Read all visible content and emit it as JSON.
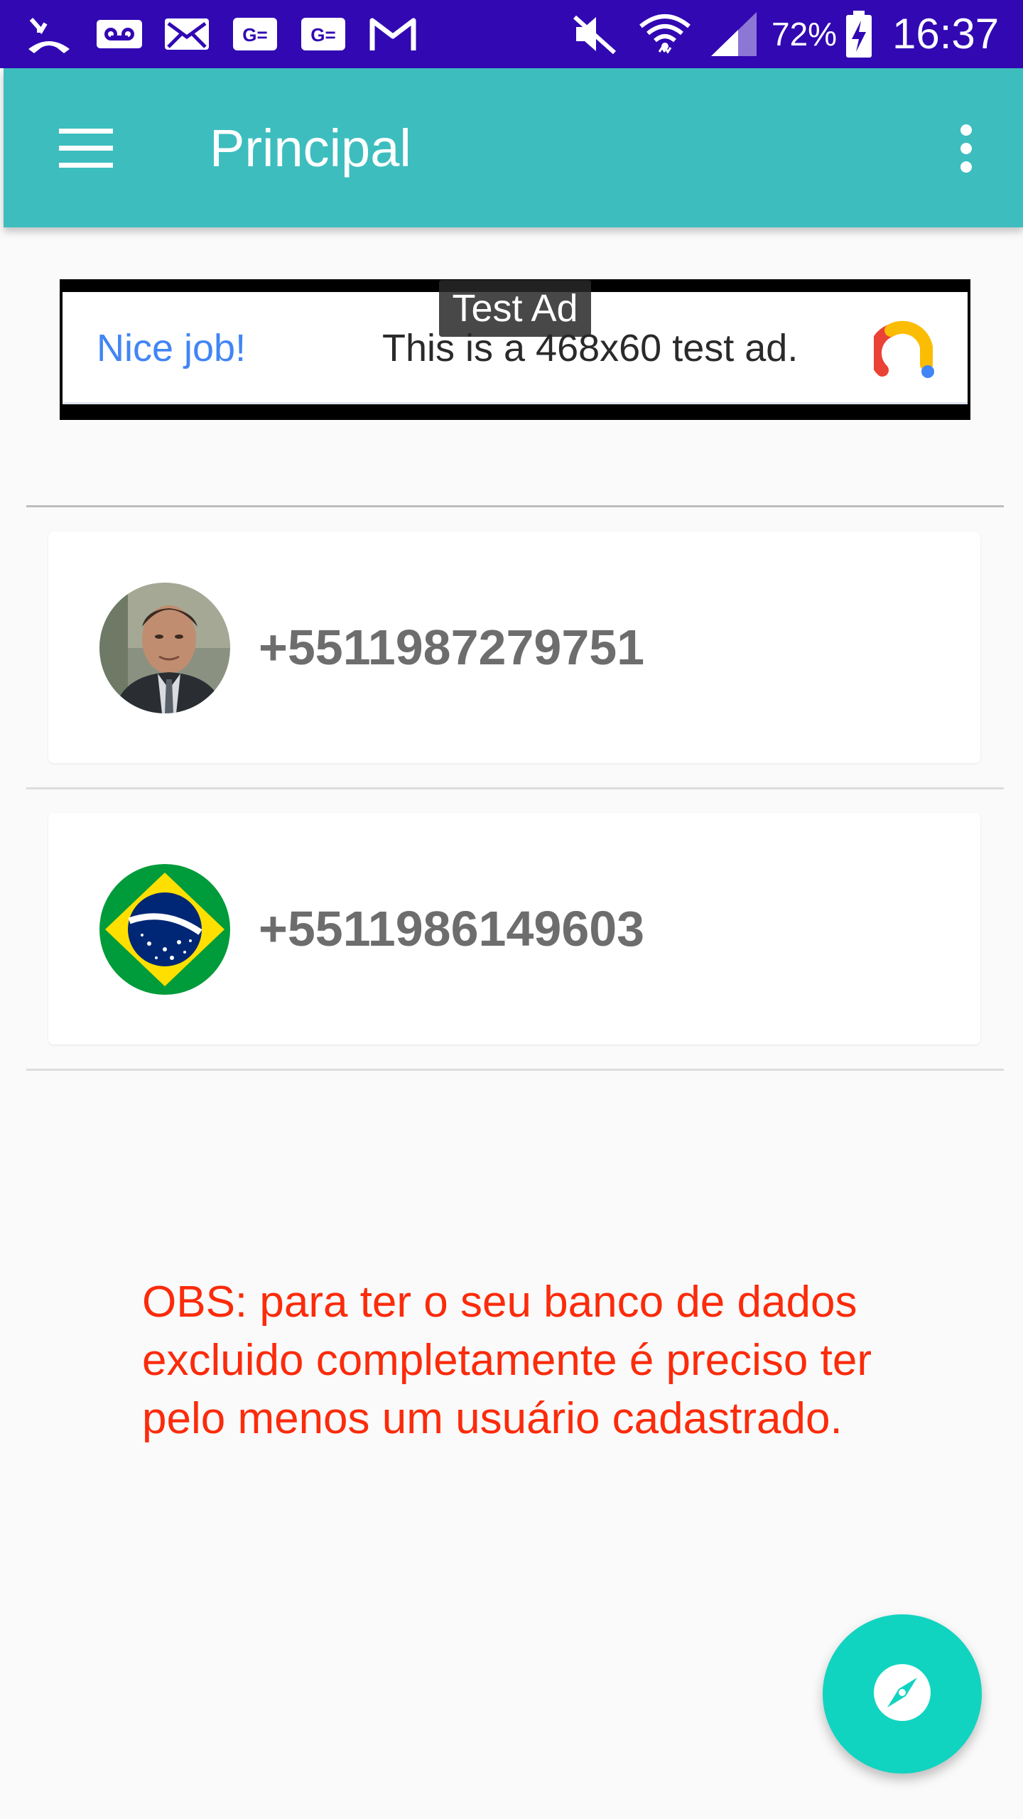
{
  "status_bar": {
    "icons": [
      "missed-call-icon",
      "voicemail-icon",
      "email-icon",
      "ge-app-icon",
      "ge-app-icon",
      "gmail-icon",
      "mute-icon",
      "wifi-icon",
      "cell-signal-icon",
      "battery-charging-icon"
    ],
    "battery": "72%",
    "time": "16:37"
  },
  "app_bar": {
    "title": "Principal",
    "menu_icon": "hamburger-menu-icon",
    "overflow_icon": "more-vert-icon"
  },
  "ad": {
    "label": "Test Ad",
    "headline": "Nice job!",
    "body": "This is a 468x60 test ad.",
    "logo_icon": "ad-logo-icon"
  },
  "contacts": [
    {
      "number": "+5511987279751",
      "avatar": "person-photo"
    },
    {
      "number": "+5511986149603",
      "avatar": "brazil-flag"
    }
  ],
  "note": "OBS: para ter o seu banco de dados excluido completamente é preciso ter pelo menos um usuário cadastrado.",
  "fab": {
    "icon": "compass-icon"
  },
  "colors": {
    "status_bar": "#3108b2",
    "app_bar": "#3dbdbe",
    "fab": "#10d4c0",
    "note_text": "#fb2b0b",
    "ad_headline": "#4285f4"
  }
}
